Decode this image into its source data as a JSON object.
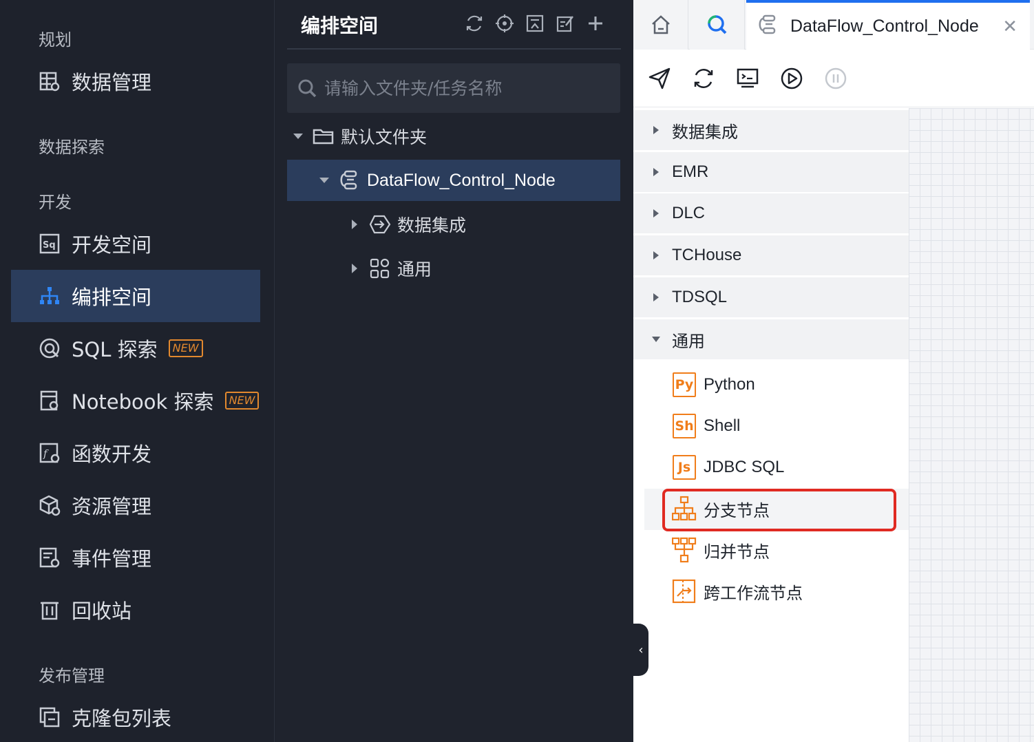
{
  "nav": {
    "sections": {
      "plan": "规划",
      "explore": "数据探索",
      "develop": "开发",
      "publish": "发布管理"
    },
    "items": {
      "data_mgmt": "数据管理",
      "dev_space": "开发空间",
      "orchestration": "编排空间",
      "sql_explore": "SQL 探索",
      "notebook_explore": "Notebook 探索",
      "func_dev": "函数开发",
      "resource_mgmt": "资源管理",
      "event_mgmt": "事件管理",
      "recycle": "回收站",
      "clone_list": "克隆包列表"
    },
    "badge_new": "NEW"
  },
  "mid": {
    "title": "编排空间",
    "search_placeholder": "请输入文件夹/任务名称",
    "tree": {
      "folder": "默认文件夹",
      "flow": "DataFlow_Control_Node",
      "child1": "数据集成",
      "child2": "通用"
    }
  },
  "right": {
    "tab_label": "DataFlow_Control_Node",
    "tab_close": "✕",
    "categories": {
      "c1": "数据集成",
      "c2": "EMR",
      "c3": "DLC",
      "c4": "TCHouse",
      "c5": "TDSQL",
      "c6": "通用"
    },
    "nodes": {
      "python": "Python",
      "python_ico": "Py",
      "shell": "Shell",
      "shell_ico": "Sh",
      "jdbc": "JDBC SQL",
      "jdbc_ico": "Js",
      "branch": "分支节点",
      "merge": "归并节点",
      "cross": "跨工作流节点"
    }
  },
  "colors": {
    "nav_bg": "#1e222c",
    "active_bg": "#2b3d5c",
    "accent_blue": "#1f6fef",
    "node_orange": "#f07d1a",
    "highlight_red": "#e02a22"
  },
  "icons": {
    "collapse": "‹"
  }
}
